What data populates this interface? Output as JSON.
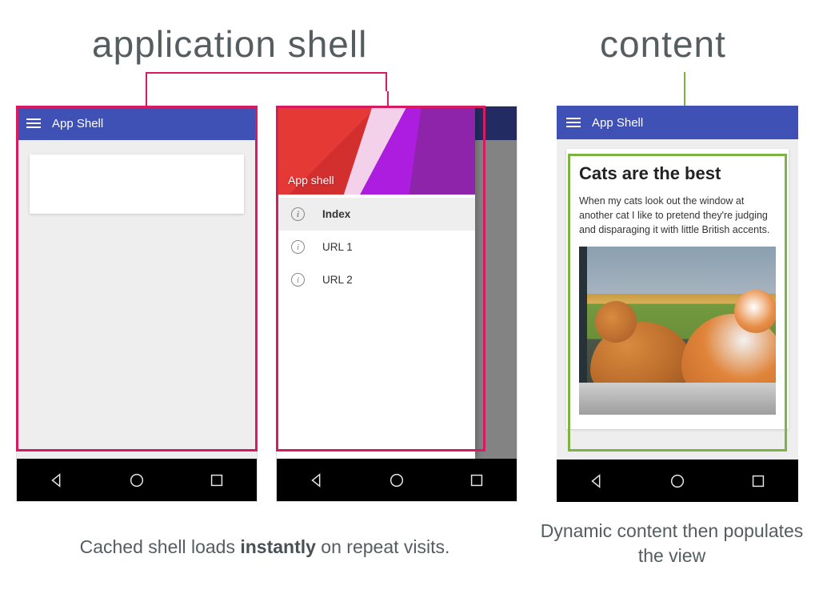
{
  "headings": {
    "shell": "application shell",
    "content": "content"
  },
  "colors": {
    "shell_highlight": "#d81b60",
    "content_highlight": "#7cb342",
    "appbar": "#3f51b5"
  },
  "appbar": {
    "title": "App Shell"
  },
  "drawer": {
    "header_title": "App shell",
    "items": [
      {
        "label": "Index",
        "active": true
      },
      {
        "label": "URL 1",
        "active": false
      },
      {
        "label": "URL 2",
        "active": false
      }
    ]
  },
  "content_card": {
    "title": "Cats are the best",
    "body": "When my cats look out the window at another cat I like to pretend they're judging and disparaging it with little British accents."
  },
  "captions": {
    "left_pre": "Cached shell loads ",
    "left_bold": "instantly",
    "left_post": " on repeat visits.",
    "right": "Dynamic content then populates the view"
  },
  "nav_icons": {
    "back": "back-triangle",
    "home": "circle",
    "recent": "square"
  }
}
